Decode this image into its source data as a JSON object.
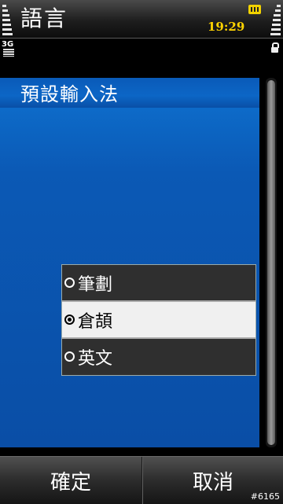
{
  "status_bar": {
    "app_title": "語言",
    "time": "19:29",
    "network": "3G",
    "sim_icon": "sim-card-icon",
    "lock_icon": "keypad-lock-icon"
  },
  "dialog": {
    "title": "預設輸入法",
    "options": [
      {
        "label": "筆劃",
        "selected": false
      },
      {
        "label": "倉頡",
        "selected": true
      },
      {
        "label": "英文",
        "selected": false
      }
    ]
  },
  "softkeys": {
    "left_label": "確定",
    "right_label": "取消"
  },
  "watermark": "#6165",
  "colors": {
    "clock": "#ffd400",
    "panel_blue": "#0b5ab8",
    "selected_row": "#f0f0f0"
  }
}
